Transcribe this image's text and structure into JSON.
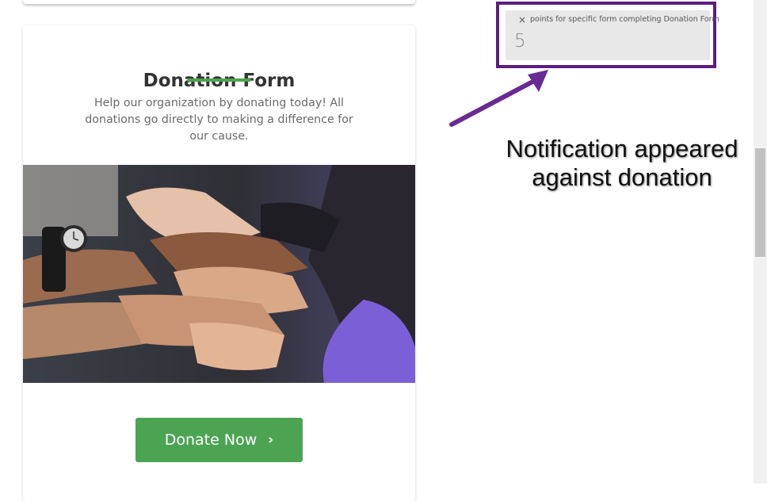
{
  "card": {
    "title": "Donation Form",
    "description": "Help our organization by donating today! All donations go directly to making a difference for our cause.",
    "button_label": "Donate Now",
    "image_alt": "hands stacked together"
  },
  "notification": {
    "close_glyph": "×",
    "message": "points for specific form completing Donation Form",
    "value": "5"
  },
  "annotation": {
    "text": "Notification appeared against donation"
  },
  "colors": {
    "accent_green": "#4ca452",
    "annotation_purple": "#5c1e7f"
  },
  "icons": {
    "button": "chevron-right-icon",
    "notification": "close-icon"
  }
}
